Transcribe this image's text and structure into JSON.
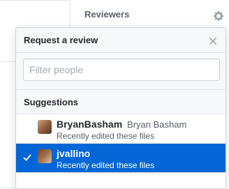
{
  "sidebar": {
    "reviewers_label": "Reviewers"
  },
  "popover": {
    "title": "Request a review",
    "filter_placeholder": "Filter people",
    "suggestions_label": "Suggestions",
    "suggestions": [
      {
        "login": "BryanBasham",
        "full_name": "Bryan Basham",
        "description": "Recently edited these files",
        "selected": false
      },
      {
        "login": "jvallino",
        "full_name": "",
        "description": "Recently edited these files",
        "selected": true
      }
    ]
  },
  "colors": {
    "selected_bg": "#0366d6",
    "header_bg": "#f6f8fa",
    "border": "#e1e4e8"
  }
}
